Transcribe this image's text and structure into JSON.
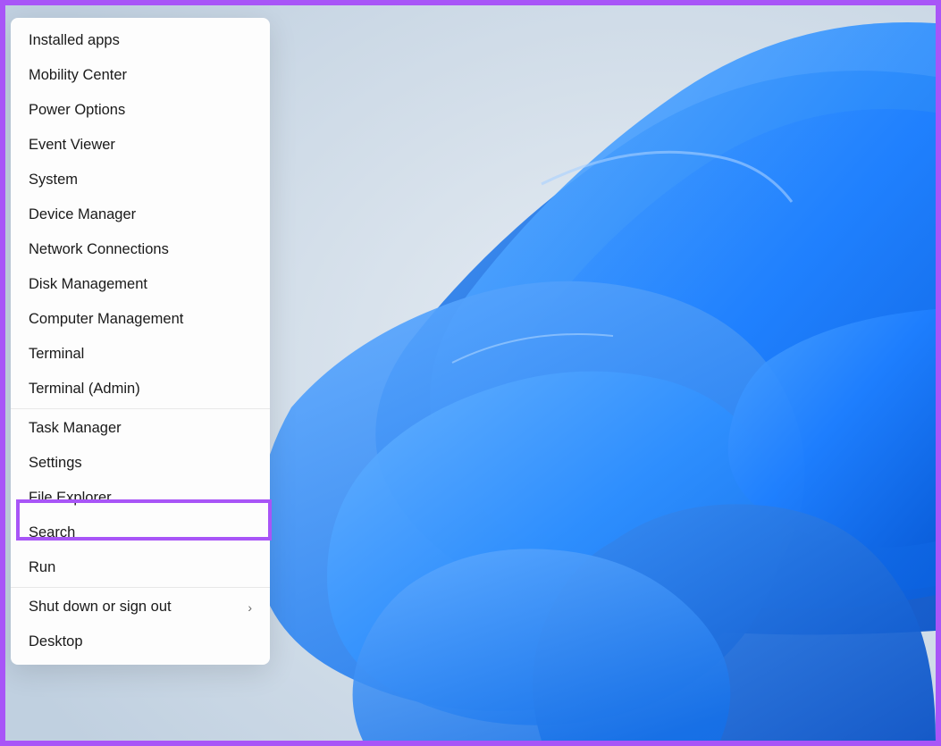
{
  "menu": {
    "items": [
      {
        "label": "Installed apps",
        "name": "menu-item-installed-apps",
        "hasSubmenu": false
      },
      {
        "label": "Mobility Center",
        "name": "menu-item-mobility-center",
        "hasSubmenu": false
      },
      {
        "label": "Power Options",
        "name": "menu-item-power-options",
        "hasSubmenu": false
      },
      {
        "label": "Event Viewer",
        "name": "menu-item-event-viewer",
        "hasSubmenu": false
      },
      {
        "label": "System",
        "name": "menu-item-system",
        "hasSubmenu": false
      },
      {
        "label": "Device Manager",
        "name": "menu-item-device-manager",
        "hasSubmenu": false
      },
      {
        "label": "Network Connections",
        "name": "menu-item-network-connections",
        "hasSubmenu": false
      },
      {
        "label": "Disk Management",
        "name": "menu-item-disk-management",
        "hasSubmenu": false
      },
      {
        "label": "Computer Management",
        "name": "menu-item-computer-management",
        "hasSubmenu": false
      },
      {
        "label": "Terminal",
        "name": "menu-item-terminal",
        "hasSubmenu": false
      },
      {
        "label": "Terminal (Admin)",
        "name": "menu-item-terminal-admin",
        "hasSubmenu": false
      }
    ],
    "items2": [
      {
        "label": "Task Manager",
        "name": "menu-item-task-manager",
        "hasSubmenu": false
      },
      {
        "label": "Settings",
        "name": "menu-item-settings",
        "hasSubmenu": false,
        "highlighted": true
      },
      {
        "label": "File Explorer",
        "name": "menu-item-file-explorer",
        "hasSubmenu": false
      },
      {
        "label": "Search",
        "name": "menu-item-search",
        "hasSubmenu": false
      },
      {
        "label": "Run",
        "name": "menu-item-run",
        "hasSubmenu": false
      }
    ],
    "items3": [
      {
        "label": "Shut down or sign out",
        "name": "menu-item-shutdown",
        "hasSubmenu": true
      },
      {
        "label": "Desktop",
        "name": "menu-item-desktop",
        "hasSubmenu": false
      }
    ]
  },
  "highlightedItem": "Settings"
}
